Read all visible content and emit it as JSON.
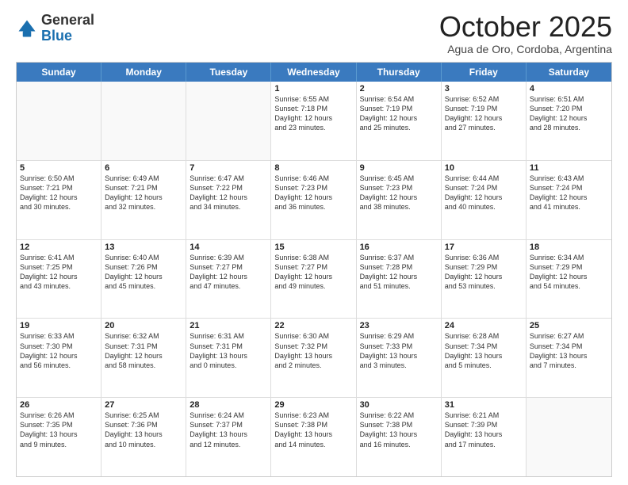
{
  "logo": {
    "general": "General",
    "blue": "Blue"
  },
  "header": {
    "month": "October 2025",
    "location": "Agua de Oro, Cordoba, Argentina"
  },
  "days": [
    "Sunday",
    "Monday",
    "Tuesday",
    "Wednesday",
    "Thursday",
    "Friday",
    "Saturday"
  ],
  "weeks": [
    [
      {
        "day": "",
        "content": ""
      },
      {
        "day": "",
        "content": ""
      },
      {
        "day": "",
        "content": ""
      },
      {
        "day": "1",
        "content": "Sunrise: 6:55 AM\nSunset: 7:18 PM\nDaylight: 12 hours\nand 23 minutes."
      },
      {
        "day": "2",
        "content": "Sunrise: 6:54 AM\nSunset: 7:19 PM\nDaylight: 12 hours\nand 25 minutes."
      },
      {
        "day": "3",
        "content": "Sunrise: 6:52 AM\nSunset: 7:19 PM\nDaylight: 12 hours\nand 27 minutes."
      },
      {
        "day": "4",
        "content": "Sunrise: 6:51 AM\nSunset: 7:20 PM\nDaylight: 12 hours\nand 28 minutes."
      }
    ],
    [
      {
        "day": "5",
        "content": "Sunrise: 6:50 AM\nSunset: 7:21 PM\nDaylight: 12 hours\nand 30 minutes."
      },
      {
        "day": "6",
        "content": "Sunrise: 6:49 AM\nSunset: 7:21 PM\nDaylight: 12 hours\nand 32 minutes."
      },
      {
        "day": "7",
        "content": "Sunrise: 6:47 AM\nSunset: 7:22 PM\nDaylight: 12 hours\nand 34 minutes."
      },
      {
        "day": "8",
        "content": "Sunrise: 6:46 AM\nSunset: 7:23 PM\nDaylight: 12 hours\nand 36 minutes."
      },
      {
        "day": "9",
        "content": "Sunrise: 6:45 AM\nSunset: 7:23 PM\nDaylight: 12 hours\nand 38 minutes."
      },
      {
        "day": "10",
        "content": "Sunrise: 6:44 AM\nSunset: 7:24 PM\nDaylight: 12 hours\nand 40 minutes."
      },
      {
        "day": "11",
        "content": "Sunrise: 6:43 AM\nSunset: 7:24 PM\nDaylight: 12 hours\nand 41 minutes."
      }
    ],
    [
      {
        "day": "12",
        "content": "Sunrise: 6:41 AM\nSunset: 7:25 PM\nDaylight: 12 hours\nand 43 minutes."
      },
      {
        "day": "13",
        "content": "Sunrise: 6:40 AM\nSunset: 7:26 PM\nDaylight: 12 hours\nand 45 minutes."
      },
      {
        "day": "14",
        "content": "Sunrise: 6:39 AM\nSunset: 7:27 PM\nDaylight: 12 hours\nand 47 minutes."
      },
      {
        "day": "15",
        "content": "Sunrise: 6:38 AM\nSunset: 7:27 PM\nDaylight: 12 hours\nand 49 minutes."
      },
      {
        "day": "16",
        "content": "Sunrise: 6:37 AM\nSunset: 7:28 PM\nDaylight: 12 hours\nand 51 minutes."
      },
      {
        "day": "17",
        "content": "Sunrise: 6:36 AM\nSunset: 7:29 PM\nDaylight: 12 hours\nand 53 minutes."
      },
      {
        "day": "18",
        "content": "Sunrise: 6:34 AM\nSunset: 7:29 PM\nDaylight: 12 hours\nand 54 minutes."
      }
    ],
    [
      {
        "day": "19",
        "content": "Sunrise: 6:33 AM\nSunset: 7:30 PM\nDaylight: 12 hours\nand 56 minutes."
      },
      {
        "day": "20",
        "content": "Sunrise: 6:32 AM\nSunset: 7:31 PM\nDaylight: 12 hours\nand 58 minutes."
      },
      {
        "day": "21",
        "content": "Sunrise: 6:31 AM\nSunset: 7:31 PM\nDaylight: 13 hours\nand 0 minutes."
      },
      {
        "day": "22",
        "content": "Sunrise: 6:30 AM\nSunset: 7:32 PM\nDaylight: 13 hours\nand 2 minutes."
      },
      {
        "day": "23",
        "content": "Sunrise: 6:29 AM\nSunset: 7:33 PM\nDaylight: 13 hours\nand 3 minutes."
      },
      {
        "day": "24",
        "content": "Sunrise: 6:28 AM\nSunset: 7:34 PM\nDaylight: 13 hours\nand 5 minutes."
      },
      {
        "day": "25",
        "content": "Sunrise: 6:27 AM\nSunset: 7:34 PM\nDaylight: 13 hours\nand 7 minutes."
      }
    ],
    [
      {
        "day": "26",
        "content": "Sunrise: 6:26 AM\nSunset: 7:35 PM\nDaylight: 13 hours\nand 9 minutes."
      },
      {
        "day": "27",
        "content": "Sunrise: 6:25 AM\nSunset: 7:36 PM\nDaylight: 13 hours\nand 10 minutes."
      },
      {
        "day": "28",
        "content": "Sunrise: 6:24 AM\nSunset: 7:37 PM\nDaylight: 13 hours\nand 12 minutes."
      },
      {
        "day": "29",
        "content": "Sunrise: 6:23 AM\nSunset: 7:38 PM\nDaylight: 13 hours\nand 14 minutes."
      },
      {
        "day": "30",
        "content": "Sunrise: 6:22 AM\nSunset: 7:38 PM\nDaylight: 13 hours\nand 16 minutes."
      },
      {
        "day": "31",
        "content": "Sunrise: 6:21 AM\nSunset: 7:39 PM\nDaylight: 13 hours\nand 17 minutes."
      },
      {
        "day": "",
        "content": ""
      }
    ]
  ]
}
